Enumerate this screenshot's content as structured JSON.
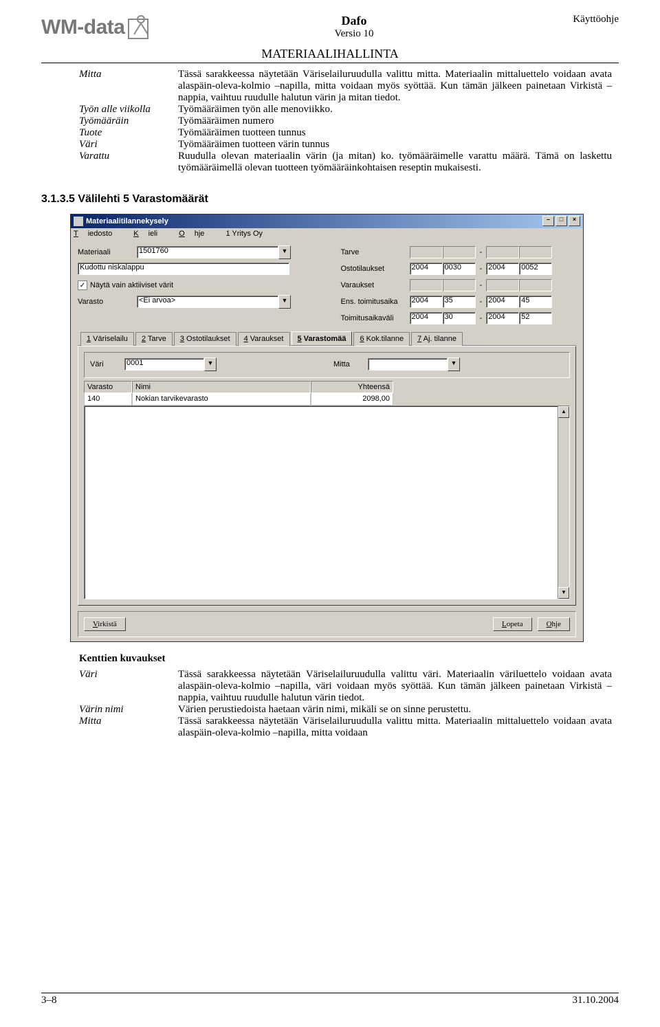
{
  "header": {
    "logo_text": "WM-data",
    "doc_title": "Dafo",
    "doc_version": "Versio 10",
    "doc_type": "Käyttöohje",
    "section_title": "MATERIAALIHALLINTA"
  },
  "definitions_top": [
    {
      "term": "Mitta",
      "body": "Tässä sarakkeessa näytetään Väriselailuruudulla valittu mitta. Materiaalin mittaluettelo voidaan avata alaspäin-oleva-kolmio –napilla, mitta voidaan myös syöttää. Kun tämän jälkeen painetaan Virkistä –nappia, vaihtuu ruudulle halutun värin ja mitan tiedot."
    },
    {
      "term": "Työn alle viikolla",
      "body": "Työmääräimen työn alle menoviikko."
    },
    {
      "term": "Työmääräin",
      "body": "Työmääräimen numero"
    },
    {
      "term": "Tuote",
      "body": "Työmääräimen tuotteen tunnus"
    },
    {
      "term": "Väri",
      "body": "Työmääräimen tuotteen värin tunnus"
    },
    {
      "term": "Varattu",
      "body": "Ruudulla olevan materiaalin värin (ja mitan) ko. työmääräimelle varattu määrä. Tämä on laskettu työmääräimellä olevan tuotteen työmääräinkohtaisen reseptin mukaisesti."
    }
  ],
  "section_heading": "3.1.3.5 Välilehti 5 Varastomäärät",
  "win": {
    "title": "Materiaalitilannekysely",
    "menu": {
      "m1_pre": "",
      "m1_u": "T",
      "m1_post": "iedosto",
      "m2_pre": "",
      "m2_u": "K",
      "m2_post": "ieli",
      "m3_pre": "",
      "m3_u": "O",
      "m3_post": "hje",
      "m4": "1 Yritys Oy"
    },
    "left_form": {
      "material_label": "Materiaali",
      "material_value": "1501760",
      "descr_value": "Kudottu niskalappu",
      "check_label": "Näytä vain aktiiviset värit",
      "check_checked": "✓",
      "varasto_label": "Varasto",
      "varasto_value": "<Ei arvoa>"
    },
    "right_form": {
      "tarve_label": "Tarve",
      "osto_label": "Ostotilaukset",
      "osto_y1": "2004",
      "osto_w1": "0030",
      "osto_y2": "2004",
      "osto_w2": "0052",
      "var_label": "Varaukset",
      "ens_label": "Ens. toimitusaika",
      "ens_y1": "2004",
      "ens_w1": "35",
      "ens_y2": "2004",
      "ens_w2": "45",
      "tav_label": "Toimitusaikaväli",
      "tav_y1": "2004",
      "tav_w1": "30",
      "tav_y2": "2004",
      "tav_w2": "52"
    },
    "tabs": {
      "t1": "1 Väriselailu",
      "t1u": "1",
      "t2": "2 Tarve",
      "t2u": "2",
      "t3": "3 Ostotilaukset",
      "t3u": "3",
      "t4": "4 Varaukset",
      "t4u": "4",
      "t5": "5 Varastomää",
      "t5u": "5",
      "t6": "6 Kok.tilanne",
      "t6u": "6",
      "t7": "7 Aj. tilanne",
      "t7u": "7"
    },
    "subform": {
      "vari_label": "Väri",
      "vari_value": "0001",
      "mitta_label": "Mitta",
      "mitta_value": ""
    },
    "table": {
      "h_varasto": "Varasto",
      "h_nimi": "Nimi",
      "h_yht": "Yhteensä",
      "r1_varasto": "140",
      "r1_nimi": "Nokian tarvikevarasto",
      "r1_yht": "2098,00"
    },
    "buttons": {
      "virkista": "Virkistä",
      "lopeta": "Lopeta",
      "ohje": "Ohje"
    },
    "drop_glyph": "▼",
    "up": "▲",
    "dn": "▼"
  },
  "subhead_kentat": "Kenttien kuvaukset",
  "definitions_bottom": [
    {
      "term": "Väri",
      "body": "Tässä sarakkeessa näytetään Väriselailuruudulla valittu väri. Materiaalin väriluettelo voidaan avata alaspäin-oleva-kolmio –napilla, väri voidaan myös syöttää. Kun tämän jälkeen painetaan Virkistä –nappia, vaihtuu ruudulle halutun värin tiedot."
    },
    {
      "term": "Värin nimi",
      "body": "Värien perustiedoista haetaan värin nimi, mikäli se on sinne perustettu."
    },
    {
      "term": "Mitta",
      "body": "Tässä sarakkeessa näytetään Väriselailuruudulla valittu mitta. Materiaalin mittaluettelo voidaan avata alaspäin-oleva-kolmio –napilla, mitta voidaan"
    }
  ],
  "footer": {
    "page": "3–8",
    "date": "31.10.2004"
  }
}
